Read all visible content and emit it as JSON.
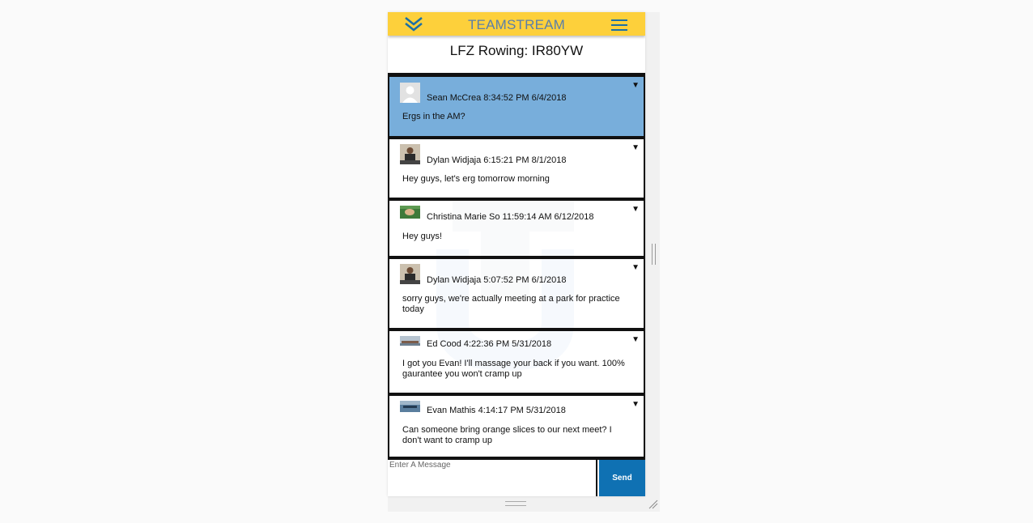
{
  "header": {
    "brand_light": "TEAM",
    "brand_bold": "STREAM",
    "menu_icon": "hamburger-icon",
    "collapse_icon": "chevron-double-down-icon",
    "color": "#fdd03b",
    "accent": "#1b6fa6"
  },
  "page": {
    "title": "LFZ Rowing: IR80YW"
  },
  "messages": [
    {
      "meta": "Sean McCrea 8:34:52 PM 6/4/2018",
      "body": "Ergs in the AM?",
      "selected": true,
      "avatar": "default-avatar"
    },
    {
      "meta": "Dylan Widjaja 6:15:21 PM 8/1/2018",
      "body": "Hey guys, let's erg tomorrow morning",
      "avatar": "photo-avatar"
    },
    {
      "meta": "Christina Marie So 11:59:14 AM 6/12/2018",
      "body": "Hey guys!",
      "avatar": "photo-avatar"
    },
    {
      "meta": "Dylan Widjaja 5:07:52 PM 6/1/2018",
      "body": "sorry guys, we're actually meeting at a park for practice today",
      "avatar": "photo-avatar"
    },
    {
      "meta": "Ed Cood 4:22:36 PM 5/31/2018",
      "body": "I got you Evan! I'll massage your back if you want. 100% gaurantee you won't cramp up",
      "avatar": "photo-avatar"
    },
    {
      "meta": "Evan Mathis 4:14:17 PM 5/31/2018",
      "body": "Can someone bring orange slices to our next meet? I don't want to cramp up",
      "avatar": "photo-avatar"
    }
  ],
  "composer": {
    "placeholder": "Enter A Message",
    "send_label": "Send",
    "send_color": "#0f71b3"
  },
  "caret_glyph": "▼",
  "selected_color": "#78aedb"
}
